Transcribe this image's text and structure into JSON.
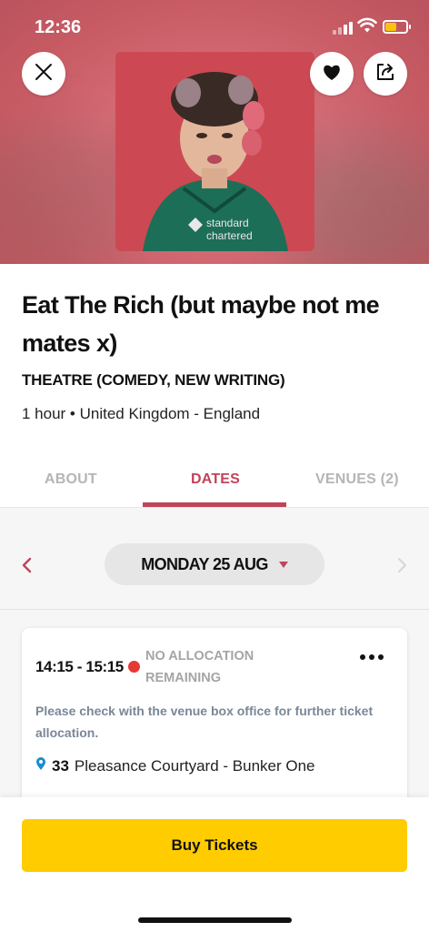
{
  "status_bar": {
    "time": "12:36"
  },
  "event": {
    "title": "Eat The Rich (but maybe not me mates x)",
    "category": "THEATRE (COMEDY, NEW WRITING)",
    "meta": "1 hour • United Kingdom - England",
    "poster_text": "standard chartered"
  },
  "tabs": [
    {
      "label": "ABOUT"
    },
    {
      "label": "DATES",
      "active": true
    },
    {
      "label": "VENUES (2)"
    }
  ],
  "date_nav": {
    "selected": "MONDAY 25 AUG"
  },
  "performance": {
    "time": "14:15 - 15:15",
    "status": "NO ALLOCATION REMAINING",
    "status_color": "#e53935",
    "note": "Please check with the venue box office for further ticket allocation.",
    "venue_number": "33",
    "venue_name": "Pleasance Courtyard - Bunker One"
  },
  "actions": {
    "buy_label": "Buy Tickets"
  },
  "colors": {
    "accent": "#c0435a",
    "buy_button": "#ffcc00"
  }
}
